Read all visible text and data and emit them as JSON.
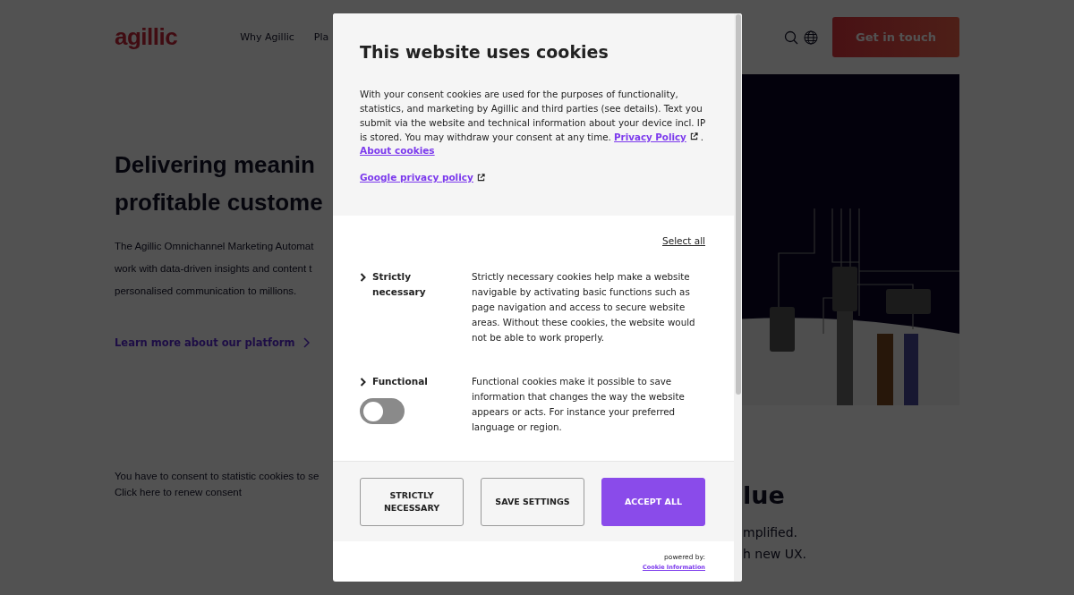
{
  "header": {
    "logo": "agillic",
    "nav": [
      "Why Agillic",
      "Pla"
    ],
    "cta": "Get in touch"
  },
  "hero": {
    "title_lines": [
      "Delivering meanin",
      "profitable custome"
    ],
    "body_lines": [
      "The Agillic Omnichannel Marketing Automat",
      "work with data-driven insights and content t",
      "personalised communication to millions."
    ],
    "link": "Learn more about our platform"
  },
  "consent_notice": [
    "You have to consent to statistic cookies to se",
    "Click here to renew consent"
  ],
  "value_section": {
    "heading": "lue",
    "lines": [
      "mplified.",
      "h new UX."
    ]
  },
  "dialog": {
    "title": "This website uses cookies",
    "intro": "With your consent cookies are used for the purposes of functionality, statistics, and marketing by Agillic and third parties (see details). Text you submit via the website and technical information about your device incl. IP is stored. You may withdraw your consent at any time.",
    "privacy_link": "Privacy Policy",
    "intro_end": ".",
    "about_link": "About cookies",
    "google_link": "Google privacy policy",
    "select_all": "Select all",
    "categories": [
      {
        "kind": "fixed",
        "name": "Strictly necessary",
        "expanded": false,
        "description": "Strictly necessary cookies help make a website navigable by activating basic functions such as page navigation and access to secure website areas. Without these cookies, the website would not be able to work properly."
      },
      {
        "kind": "toggle",
        "name": "Functional",
        "expanded": false,
        "on": false,
        "description": "Functional cookies make it possible to save information that changes the way the website appears or acts. For instance your preferred language or region."
      }
    ],
    "buttons": [
      {
        "kind": "outline",
        "label": "STRICTLY NECESSARY"
      },
      {
        "kind": "outline",
        "label": "SAVE SETTINGS"
      },
      {
        "kind": "primary",
        "label": "ACCEPT ALL"
      }
    ],
    "powered_by": "powered by:",
    "provider_link": "Cookie Information"
  }
}
